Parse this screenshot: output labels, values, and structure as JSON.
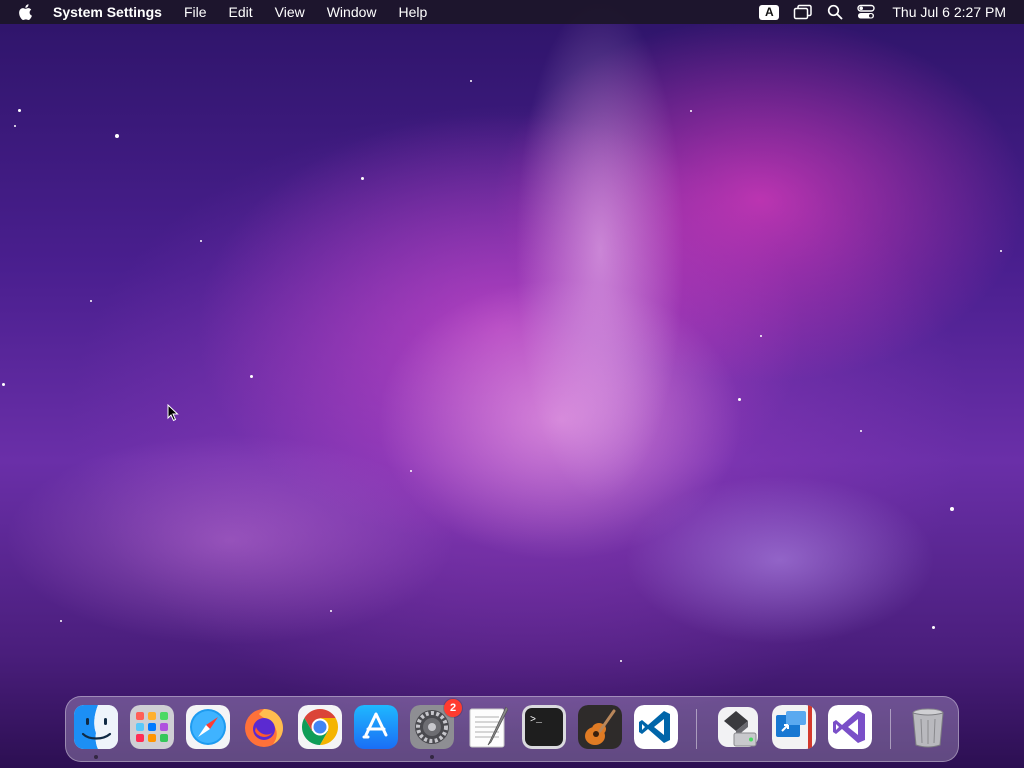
{
  "menubar": {
    "app_name": "System Settings",
    "menus": [
      "File",
      "Edit",
      "View",
      "Window",
      "Help"
    ],
    "input_source": "A",
    "clock": "Thu Jul 6  2:27 PM"
  },
  "dock": {
    "apps": [
      {
        "name": "Finder",
        "icon": "finder-icon",
        "running": true
      },
      {
        "name": "Launchpad",
        "icon": "launchpad-icon",
        "running": false
      },
      {
        "name": "Safari",
        "icon": "safari-icon",
        "running": false
      },
      {
        "name": "Firefox",
        "icon": "firefox-icon",
        "running": false
      },
      {
        "name": "Google Chrome",
        "icon": "chrome-icon",
        "running": false
      },
      {
        "name": "App Store",
        "icon": "app-store-icon",
        "running": false
      },
      {
        "name": "System Settings",
        "icon": "system-settings-icon",
        "running": true,
        "badge": "2"
      },
      {
        "name": "TextEdit",
        "icon": "textedit-icon",
        "running": false
      },
      {
        "name": "Terminal",
        "icon": "terminal-icon",
        "running": false
      },
      {
        "name": "GarageBand",
        "icon": "garageband-icon",
        "running": false
      },
      {
        "name": "Visual Studio Code",
        "icon": "vscode-icon",
        "running": false
      }
    ],
    "extras": [
      {
        "name": "Disk Utility",
        "icon": "disk-utility-icon"
      },
      {
        "name": "Microsoft Remote Desktop",
        "icon": "remote-desktop-icon"
      },
      {
        "name": "Visual Studio",
        "icon": "visual-studio-icon"
      }
    ],
    "trash": {
      "name": "Trash",
      "icon": "trash-icon"
    }
  },
  "colors": {
    "menubar_bg": "#1c1628",
    "badge": "#ff3b30",
    "vscode_blue": "#0065a9",
    "vs_purple": "#7a4fc8"
  }
}
